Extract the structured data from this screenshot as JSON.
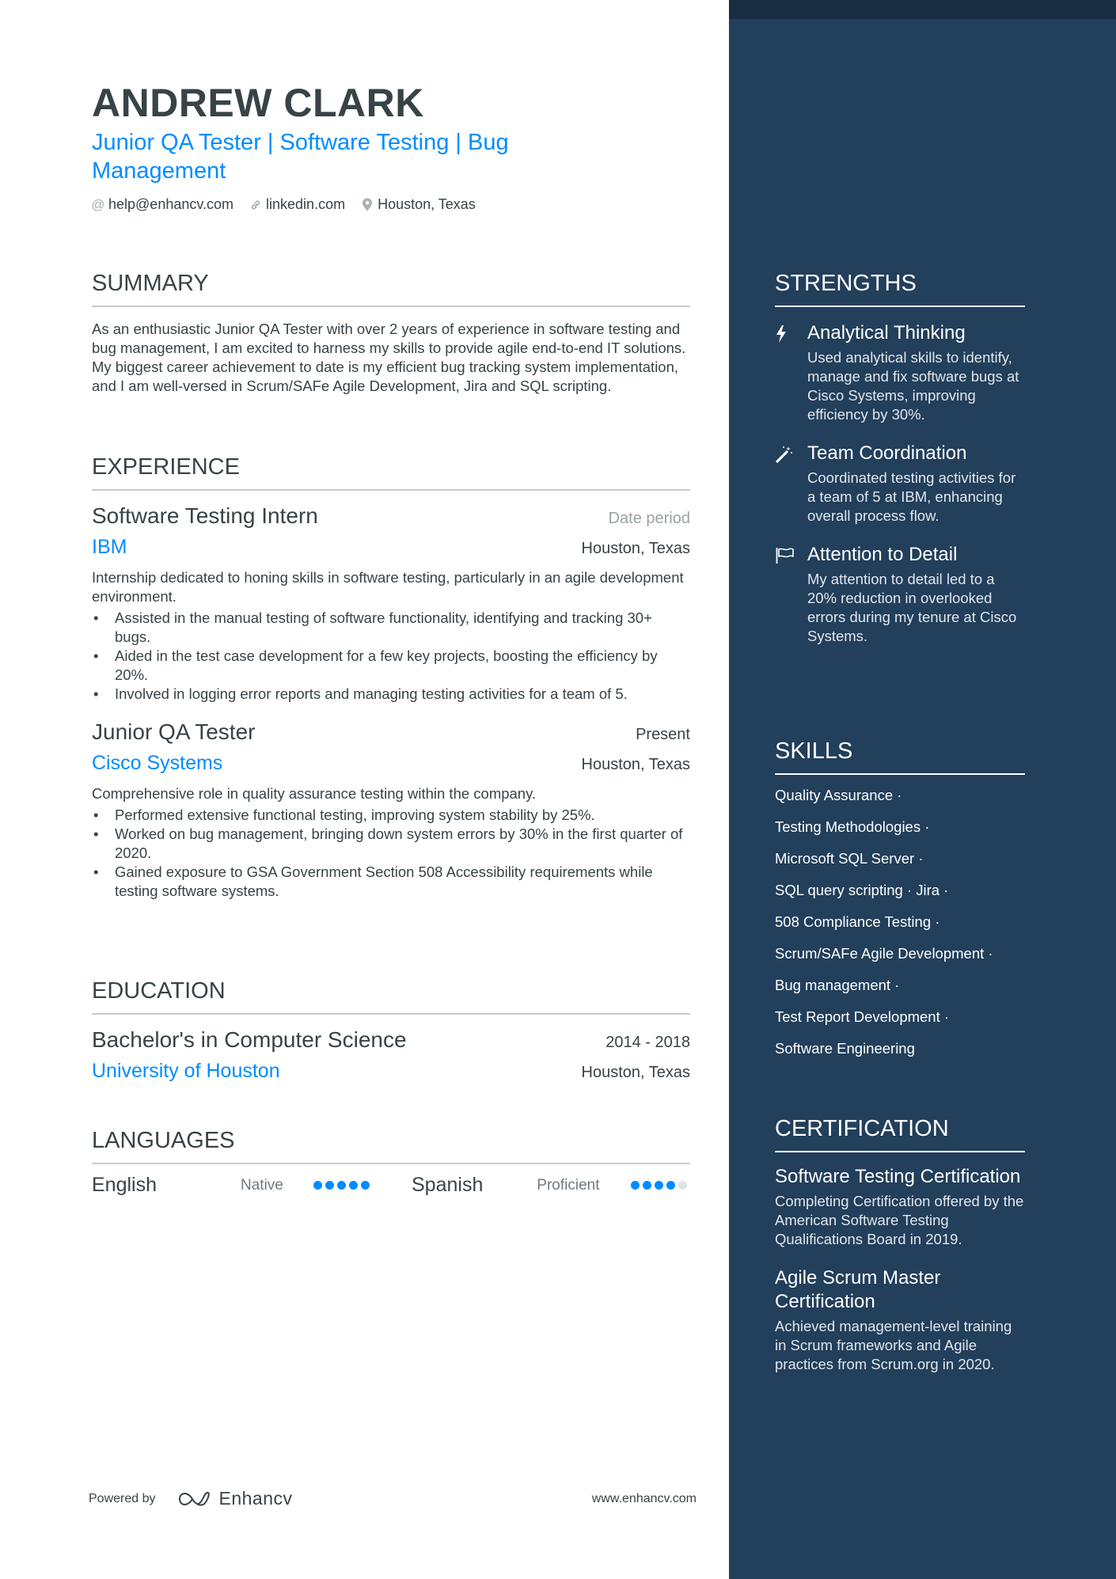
{
  "header": {
    "name": "ANDREW CLARK",
    "title": "Junior QA Tester | Software Testing | Bug Management",
    "contacts": [
      {
        "icon": "at-icon",
        "text": "help@enhancv.com"
      },
      {
        "icon": "link-icon",
        "text": "linkedin.com"
      },
      {
        "icon": "location-pin-icon",
        "text": "Houston, Texas"
      }
    ]
  },
  "summary": {
    "title": "SUMMARY",
    "text": "As an enthusiastic Junior QA Tester with over 2 years of experience in software testing and bug management, I am excited to harness my skills to provide agile end-to-end IT solutions. My biggest career achievement to date is my efficient bug tracking system implementation, and I am well-versed in Scrum/SAFe Agile Development, Jira and SQL scripting."
  },
  "experience": {
    "title": "EXPERIENCE",
    "items": [
      {
        "role": "Software Testing Intern",
        "date": "Date period",
        "company": "IBM",
        "location": "Houston, Texas",
        "description": "Internship dedicated to honing skills in software testing, particularly in an agile development environment.",
        "bullets": [
          "Assisted in the manual testing of software functionality, identifying and tracking 30+ bugs.",
          "Aided in the test case development for a few key projects, boosting the efficiency by 20%.",
          "Involved in logging error reports and managing testing activities for a team of 5."
        ]
      },
      {
        "role": "Junior QA Tester",
        "date": "Present",
        "company": "Cisco Systems",
        "location": "Houston, Texas",
        "description": "Comprehensive role in quality assurance testing within the company.",
        "bullets": [
          "Performed extensive functional testing, improving system stability by 25%.",
          "Worked on bug management, bringing down system errors by 30% in the first quarter of 2020.",
          "Gained exposure to GSA Government Section 508 Accessibility requirements while testing software systems."
        ]
      }
    ]
  },
  "education": {
    "title": "EDUCATION",
    "items": [
      {
        "degree": "Bachelor's in Computer Science",
        "date": "2014 - 2018",
        "school": "University of Houston",
        "location": "Houston, Texas"
      }
    ]
  },
  "languages": {
    "title": "LANGUAGES",
    "items": [
      {
        "name": "English",
        "level": "Native",
        "rating": 5,
        "max": 5
      },
      {
        "name": "Spanish",
        "level": "Proficient",
        "rating": 4,
        "max": 5
      }
    ]
  },
  "footer": {
    "powered_by": "Powered by",
    "brand": "Enhancv",
    "website": "www.enhancv.com"
  },
  "strengths": {
    "title": "STRENGTHS",
    "items": [
      {
        "icon": "lightning-bolt-icon",
        "title": "Analytical Thinking",
        "description": "Used analytical skills to identify, manage and fix software bugs at Cisco Systems, improving efficiency by 30%."
      },
      {
        "icon": "magic-wand-icon",
        "title": "Team Coordination",
        "description": "Coordinated testing activities for a team of 5 at IBM, enhancing overall process flow."
      },
      {
        "icon": "flag-icon",
        "title": "Attention to Detail",
        "description": "My attention to detail led to a 20% reduction in overlooked errors during my tenure at Cisco Systems."
      }
    ]
  },
  "skills": {
    "title": "SKILLS",
    "lines": [
      "Quality Assurance ·",
      "Testing Methodologies ·",
      "Microsoft SQL Server ·",
      "SQL query scripting · Jira ·",
      "508 Compliance Testing ·",
      "Scrum/SAFe Agile Development ·",
      "Bug management ·",
      "Test Report Development ·",
      "Software Engineering"
    ]
  },
  "certification": {
    "title": "CERTIFICATION",
    "items": [
      {
        "title": "Software Testing Certification",
        "description": "Completing Certification offered by the American Software Testing Qualifications Board in 2019."
      },
      {
        "title": "Agile Scrum Master Certification",
        "description": "Achieved management-level training in Scrum frameworks and Agile practices from Scrum.org in 2020."
      }
    ]
  },
  "colors": {
    "accent": "#008cff",
    "sidebar": "#223f5b",
    "sidebar_top": "#1b2d43",
    "text": "#384347"
  }
}
